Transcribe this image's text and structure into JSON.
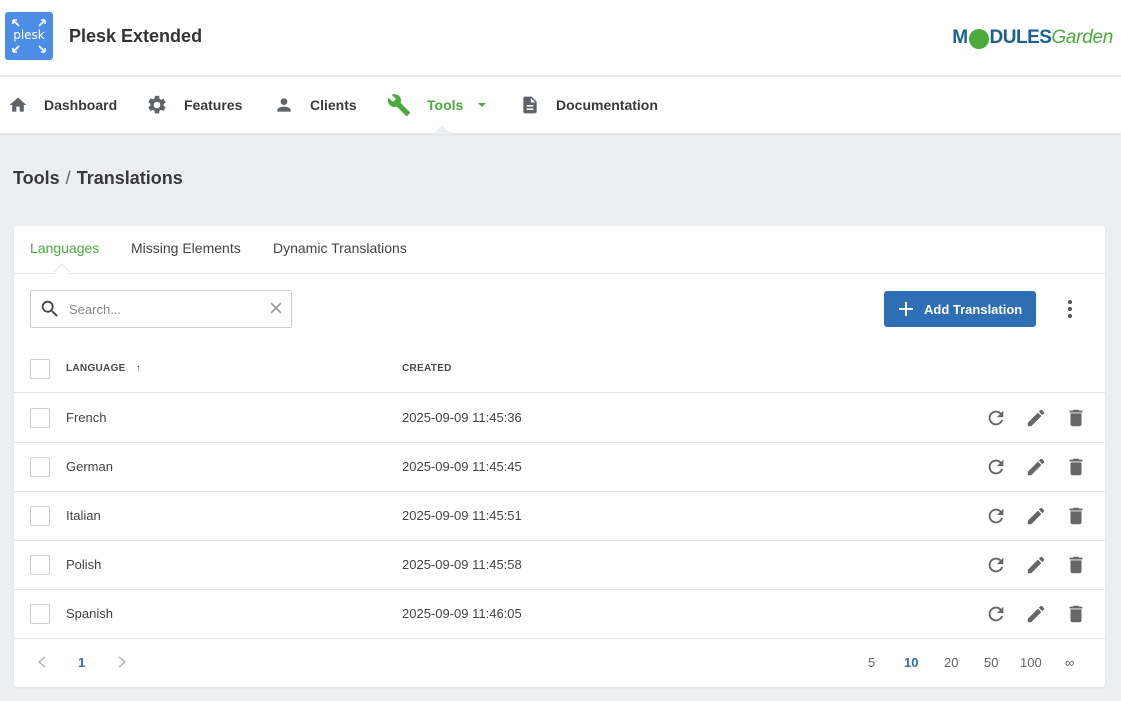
{
  "app": {
    "logo_text": "plesk",
    "title": "Plesk Extended",
    "brand_part1": "M",
    "brand_part2": "DULES",
    "brand_part3": "Garden"
  },
  "nav": {
    "items": [
      {
        "label": "Dashboard",
        "icon": "home-icon"
      },
      {
        "label": "Features",
        "icon": "gear-icon"
      },
      {
        "label": "Clients",
        "icon": "person-icon"
      },
      {
        "label": "Tools",
        "icon": "wrench-icon",
        "active": true
      },
      {
        "label": "Documentation",
        "icon": "document-icon"
      }
    ]
  },
  "breadcrumb": {
    "parent": "Tools",
    "separator": "/",
    "current": "Translations"
  },
  "tabs": [
    {
      "label": "Languages",
      "active": true
    },
    {
      "label": "Missing Elements"
    },
    {
      "label": "Dynamic Translations"
    }
  ],
  "toolbar": {
    "search_placeholder": "Search...",
    "add_label": "Add Translation"
  },
  "table": {
    "columns": {
      "language": "LANGUAGE",
      "sort_indicator": "↑",
      "created": "CREATED"
    },
    "rows": [
      {
        "language": "French",
        "created": "2025-09-09 11:45:36"
      },
      {
        "language": "German",
        "created": "2025-09-09 11:45:45"
      },
      {
        "language": "Italian",
        "created": "2025-09-09 11:45:51"
      },
      {
        "language": "Polish",
        "created": "2025-09-09 11:45:58"
      },
      {
        "language": "Spanish",
        "created": "2025-09-09 11:46:05"
      }
    ]
  },
  "pagination": {
    "current_page": "1",
    "page_sizes": [
      "5",
      "10",
      "20",
      "50",
      "100",
      "∞"
    ],
    "active_size": "10"
  },
  "colors": {
    "accent_green": "#4aaa3b",
    "primary_blue": "#2e6eb5",
    "background": "#eceef2"
  }
}
